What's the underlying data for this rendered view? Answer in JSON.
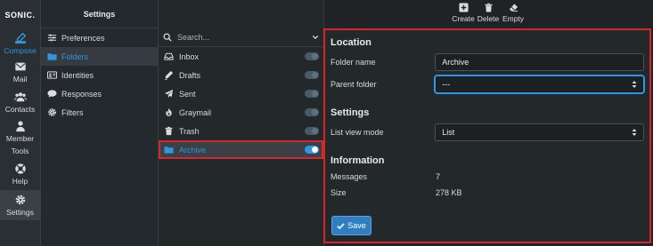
{
  "app": {
    "logo": "SONIC."
  },
  "nav": {
    "items": [
      {
        "label": "Compose"
      },
      {
        "label": "Mail"
      },
      {
        "label": "Contacts"
      },
      {
        "label_line1": "Member",
        "label_line2": "Tools"
      },
      {
        "label": "Help"
      },
      {
        "label": "Settings"
      }
    ]
  },
  "settings": {
    "title": "Settings",
    "items": [
      {
        "label": "Preferences"
      },
      {
        "label": "Folders"
      },
      {
        "label": "Identities"
      },
      {
        "label": "Responses"
      },
      {
        "label": "Filters"
      }
    ]
  },
  "folders": {
    "search_placeholder": "Search...",
    "items": [
      {
        "label": "Inbox"
      },
      {
        "label": "Drafts"
      },
      {
        "label": "Sent"
      },
      {
        "label": "Graymail"
      },
      {
        "label": "Trash"
      },
      {
        "label": "Archive"
      }
    ]
  },
  "toolbar": {
    "create": "Create",
    "delete": "Delete",
    "empty": "Empty"
  },
  "form": {
    "location_title": "Location",
    "folder_name_label": "Folder name",
    "folder_name_value": "Archive",
    "parent_folder_label": "Parent folder",
    "parent_folder_value": "---",
    "settings_title": "Settings",
    "list_view_label": "List view mode",
    "list_view_value": "List",
    "information_title": "Information",
    "messages_label": "Messages",
    "messages_value": "7",
    "size_label": "Size",
    "size_value": "278 KB",
    "save_label": "Save"
  },
  "colors": {
    "accent": "#2f97e0",
    "highlight_border": "#d6262c",
    "background": "#1f2326"
  }
}
